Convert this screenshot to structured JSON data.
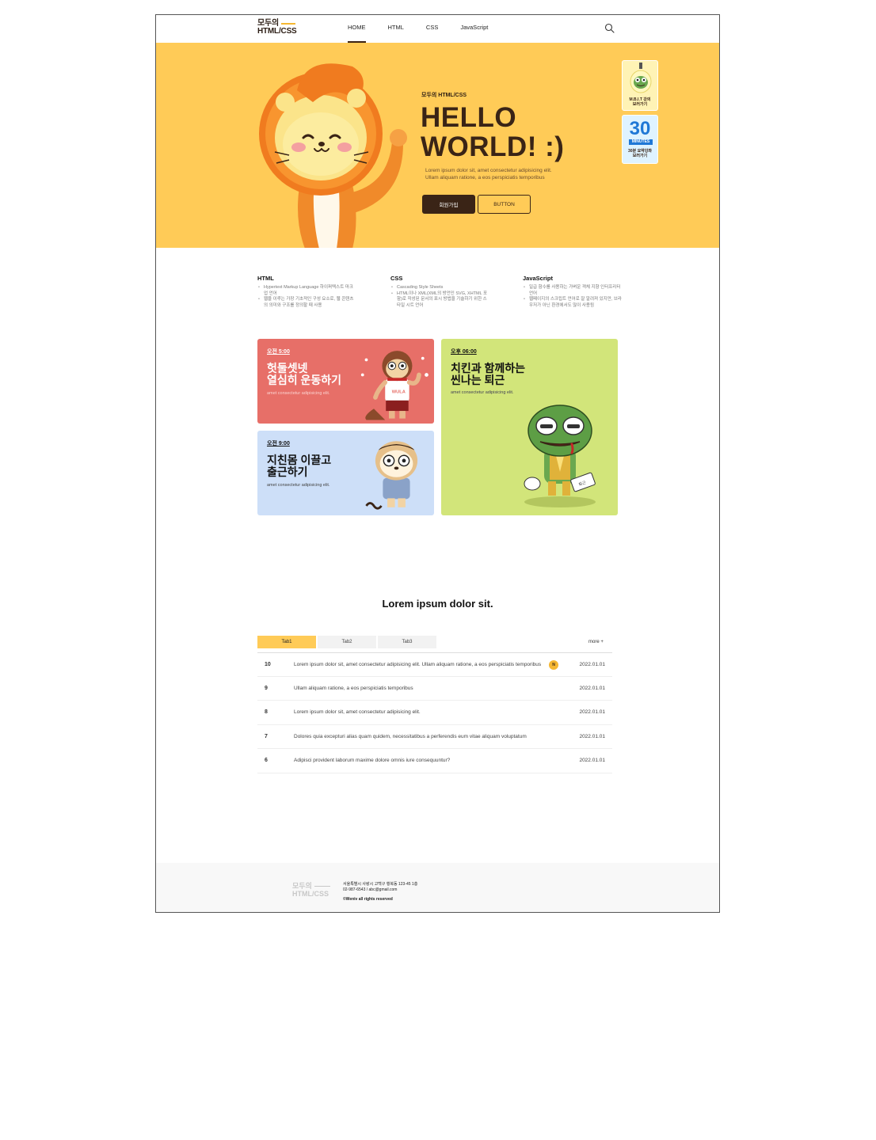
{
  "header": {
    "logo_line1": "모두의",
    "logo_line2": "HTML/CSS",
    "nav": [
      "HOME",
      "HTML",
      "CSS",
      "JavaScript"
    ],
    "active_nav": "HOME",
    "search_icon": "search-icon"
  },
  "hero": {
    "bg_color": "#ffcb57",
    "subtitle": "모두의 HTML/CSS",
    "title": "HELLO\nWORLD! :)",
    "desc_line1": "Lorem ipsum dolor sit, amet consectetur adipisicing elit.",
    "desc_line2": "Ullam aliquam ratione, a eos perspiciatis temporibus",
    "btn_primary": "회원가입",
    "btn_secondary": "BUTTON",
    "badge1_line1": "M.B.I.T 강의",
    "badge1_line2": "보러가기",
    "badge2_num": "30",
    "badge2_unit": "MINUTES",
    "badge2_line1": "30분 요약강좌",
    "badge2_line2": "보러가기"
  },
  "features": [
    {
      "title": "HTML",
      "items": [
        "Hypertext Markup Language 하이퍼텍스트 마크업 언어",
        "웹을 이루는 가장 기초적인 구성 요소로, 웹 콘텐츠의 의미와 구조를 정의할 때 사용"
      ]
    },
    {
      "title": "CSS",
      "items": [
        "Cascading Style Sheets",
        "HTML이나 XML(XML의 방언인 SVG, XHTML 포함)로 작성된 문서의 표시 방법을 기술하기 위한 스타일 시트 언어"
      ]
    },
    {
      "title": "JavaScript",
      "items": [
        "일급 함수를 사용하는 가벼운 객체 지향 인터프리터 언어",
        "웹페이지의 스크립트 언어로 잘 알려져 있지만, 브라우저가 아닌 환경에서도 많이 사용됨"
      ]
    }
  ],
  "cards": {
    "red": {
      "time": "오전 5:00",
      "title": "헛둘셋넷\n열심히 운동하기",
      "desc": "amet consectetur adipisicing elit.",
      "color": "#e76f68",
      "shirt_text": "WULA"
    },
    "blue": {
      "time": "오전 9:00",
      "title": "지친몸 이끌고\n출근하기",
      "desc": "amet consectetur adipisicing elit.",
      "color": "#cddff8"
    },
    "green": {
      "time": "오후 06:00",
      "title": "치킨과 함께하는\n씬나는 퇴근",
      "desc": "amet consectetur adipisicing elit.",
      "color": "#d2e57a",
      "bag_text": "퇴근"
    }
  },
  "board": {
    "title": "Lorem ipsum dolor sit.",
    "tabs": [
      "Tab1",
      "Tab2",
      "Tab3"
    ],
    "more": "more +",
    "rows": [
      {
        "num": "10",
        "text": "Lorem ipsum dolor sit, amet consectetur adipisicing elit. Ullam aliquam ratione, a eos perspiciatis temporibus",
        "new": "N",
        "date": "2022.01.01"
      },
      {
        "num": "9",
        "text": "Ullam aliquam ratione, a eos perspiciatis temporibus",
        "new": "",
        "date": "2022.01.01"
      },
      {
        "num": "8",
        "text": "Lorem ipsum dolor sit, amet consectetur adipisicing elit.",
        "new": "",
        "date": "2022.01.01"
      },
      {
        "num": "7",
        "text": "Dolores quia excepturi alias quam quidem, necessitatibus a perferendis eum vitae aliquam voluptatum",
        "new": "",
        "date": "2022.01.01"
      },
      {
        "num": "6",
        "text": "Adipisci provident laborum maxime dolore omnis iure consequuntur?",
        "new": "",
        "date": "2022.01.01"
      }
    ]
  },
  "footer": {
    "logo_line1": "모두의",
    "logo_line2": "HTML/CSS",
    "address": "서울특별시 사랑시 고백구 행복동 123-45 1층",
    "contact": "02-987-6543 / abc@gmail.com",
    "copyright": "©Weniv all rights reserved"
  }
}
